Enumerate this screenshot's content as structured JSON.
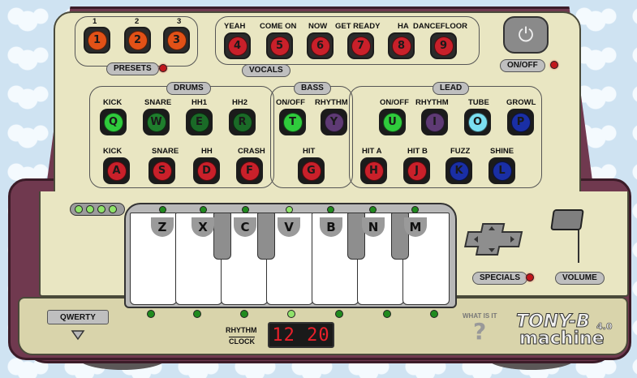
{
  "presets": {
    "label": "PRESETS",
    "numbers": [
      "1",
      "2",
      "3"
    ],
    "keys": [
      {
        "key": "1",
        "color": "#e25117"
      },
      {
        "key": "2",
        "color": "#e25117"
      },
      {
        "key": "3",
        "color": "#e25117"
      }
    ]
  },
  "vocals": {
    "label": "VOCALS",
    "items": [
      {
        "name": "YEAH",
        "key": "4"
      },
      {
        "name": "COME ON",
        "key": "5"
      },
      {
        "name": "NOW",
        "key": "6"
      },
      {
        "name": "GET READY",
        "key": "7"
      },
      {
        "name": "HA",
        "key": "8"
      },
      {
        "name": "DANCEFLOOR",
        "key": "9"
      }
    ],
    "color": "#c9202a"
  },
  "power": {
    "label": "ON/OFF",
    "glyph": "⏻"
  },
  "drums": {
    "label": "DRUMS",
    "top": [
      {
        "name": "KICK",
        "key": "Q"
      },
      {
        "name": "SNARE",
        "key": "W"
      },
      {
        "name": "HH1",
        "key": "E"
      },
      {
        "name": "HH2",
        "key": "R"
      }
    ],
    "bottom": [
      {
        "name": "KICK",
        "key": "A"
      },
      {
        "name": "SNARE",
        "key": "S"
      },
      {
        "name": "HH",
        "key": "D"
      },
      {
        "name": "CRASH",
        "key": "F"
      }
    ]
  },
  "bass": {
    "label": "BASS",
    "top": [
      {
        "name": "ON/OFF",
        "key": "T"
      },
      {
        "name": "RHYTHM",
        "key": "Y"
      }
    ],
    "bottom": [
      {
        "name": "HIT",
        "key": "G"
      }
    ]
  },
  "lead": {
    "label": "LEAD",
    "top": [
      {
        "name": "ON/OFF",
        "key": "U"
      },
      {
        "name": "RHYTHM",
        "key": "I"
      },
      {
        "name": "TUBE",
        "key": "O"
      },
      {
        "name": "GROWL",
        "key": "P"
      }
    ],
    "bottom": [
      {
        "name": "HIT A",
        "key": "H"
      },
      {
        "name": "HIT B",
        "key": "J"
      },
      {
        "name": "FUZZ",
        "key": "K"
      },
      {
        "name": "SHINE",
        "key": "L"
      }
    ]
  },
  "piano_keys": [
    "Z",
    "X",
    "C",
    "V",
    "B",
    "N",
    "M"
  ],
  "specials": {
    "label": "SPECIALS"
  },
  "volume": {
    "label": "VOLUME"
  },
  "qwerty": {
    "label": "QWERTY"
  },
  "rhythm_clock": {
    "label_line1": "RHYTHM",
    "label_line2": "CLOCK",
    "display": "12 20"
  },
  "help": {
    "label": "WHAT IS IT",
    "glyph": "?"
  },
  "brand": {
    "name_line1": "TONY-B",
    "name_line2": "machine",
    "version": "4.0"
  },
  "colors": {
    "panel": "#e9e6c2",
    "body": "#70394f",
    "accent_red": "#c9202a",
    "accent_orange": "#e25117",
    "drums_green": "#1f9c3a",
    "drums_red": "#c9202a",
    "bass_purple": "#5e3a74",
    "lead_purple": "#5e3a74",
    "lead_cyan": "#7be0f2",
    "lead_blue": "#1a2fa5",
    "led_lit": "#8fe36a"
  }
}
